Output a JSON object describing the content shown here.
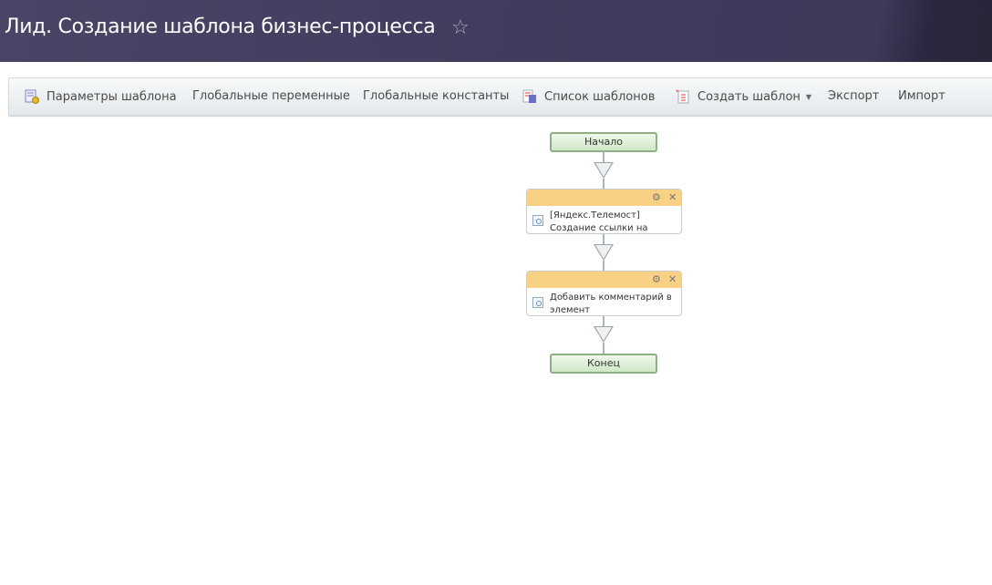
{
  "header": {
    "title": "Лид. Создание шаблона бизнес-процесса",
    "favorite_icon": "star-outline-icon"
  },
  "toolbar": {
    "template_params": "Параметры шаблона",
    "global_variables": "Глобальные переменные",
    "global_constants": "Глобальные константы",
    "template_list": "Список шаблонов",
    "create_template": "Создать шаблон",
    "export": "Экспорт",
    "import": "Импорт"
  },
  "flow": {
    "start": "Начало",
    "activities": [
      {
        "text": "[Яндекс.Телемост] Создание ссылки на"
      },
      {
        "text": "Добавить комментарий в элемент"
      }
    ],
    "end": "Конец",
    "colors": {
      "activity_header": "#f8d185",
      "terminal": "#d9eed2"
    }
  }
}
